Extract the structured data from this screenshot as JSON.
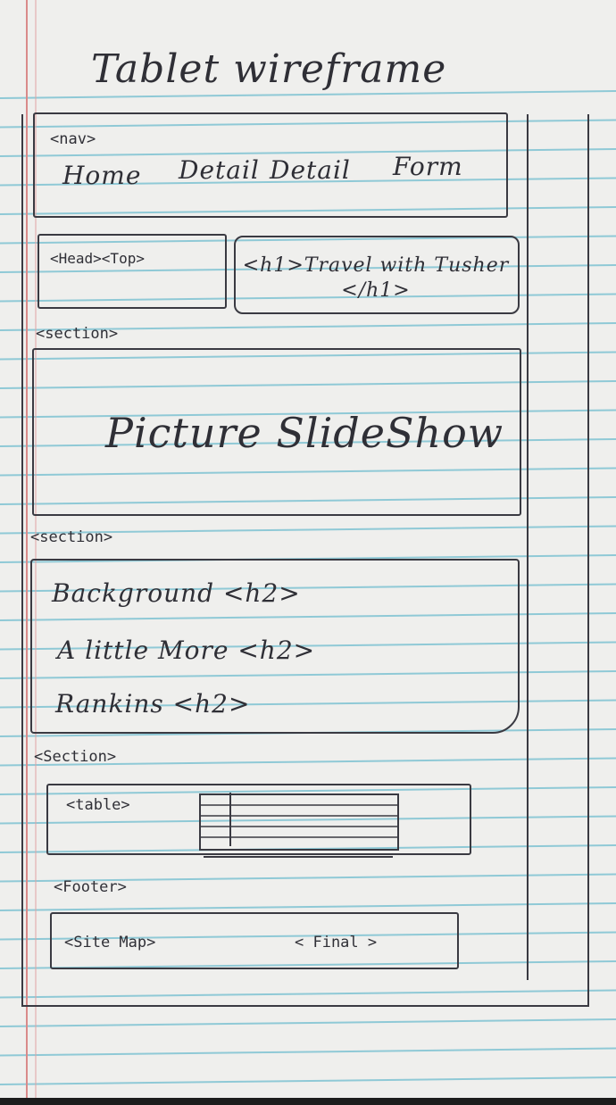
{
  "title": "Tablet wireframe",
  "nav": {
    "tag": "<nav>",
    "links": [
      "Home",
      "Detail",
      "Detail",
      "Form"
    ]
  },
  "head": {
    "tag": "<Head><Top>",
    "h1": "<h1>Travel with Tusher </h1>"
  },
  "slideshow": {
    "tag": "<section>",
    "label": "Picture SlideShow"
  },
  "content": {
    "tag": "<section>",
    "headings": [
      "Background <h2>",
      "A little More <h2>",
      "Rankins <h2>"
    ]
  },
  "table_section": {
    "tag": "<Section>",
    "table_tag": "<table>"
  },
  "footer": {
    "tag": "<Footer>",
    "site_map": "<Site Map>",
    "final": "< Final >"
  },
  "colors": {
    "ruled_line": "#8fc9d6",
    "margin_line": "#d98a8a",
    "ink": "#2f2f36",
    "paper": "#efefed"
  }
}
